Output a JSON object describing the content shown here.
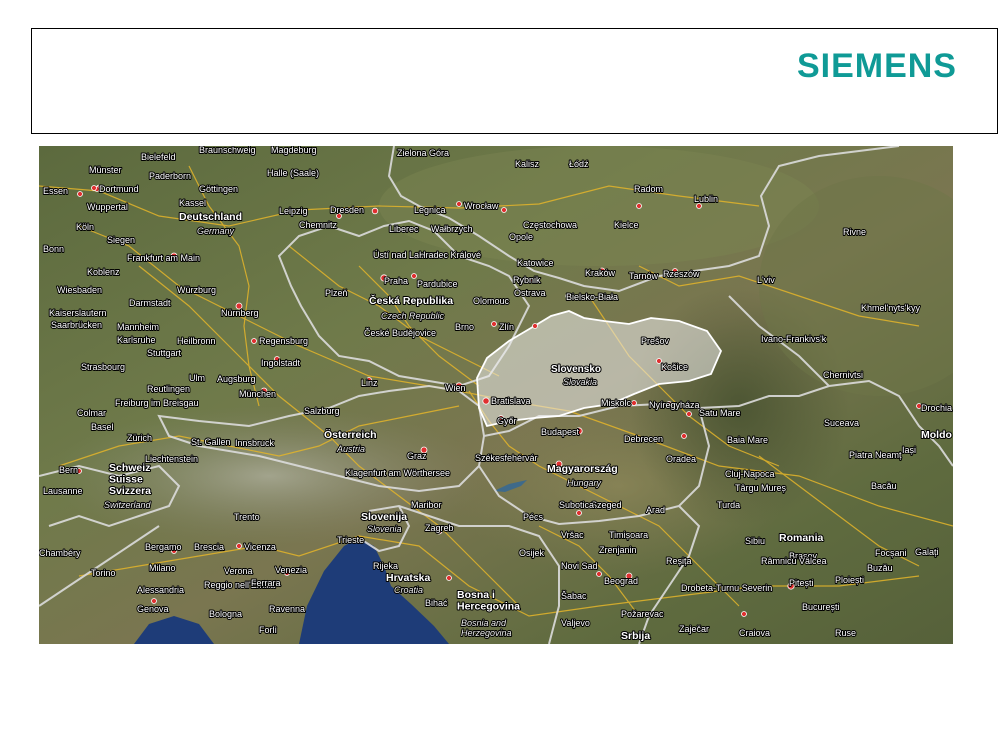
{
  "header": {
    "logo": "SIEMENS"
  },
  "colors": {
    "brand": "#0f9a96",
    "highlight": "#e8e8e8",
    "border": "#d9d9d9",
    "road": "#e4b52a"
  },
  "map": {
    "highlighted_country": {
      "name": "Slovensko",
      "english": "Slovakia"
    },
    "countries": [
      {
        "name": "Deutschland",
        "english": "Germany"
      },
      {
        "name": "Česká Republika",
        "english": "Czech Republic"
      },
      {
        "name": "Österreich",
        "english": "Austria"
      },
      {
        "name": "Magyarország",
        "english": "Hungary"
      },
      {
        "name": "Slovenija",
        "english": "Slovenia"
      },
      {
        "name": "Hrvatska",
        "english": "Croatia"
      },
      {
        "name": "Schweiz\nSuisse\nSvizzera",
        "english": "Switzerland"
      },
      {
        "name": "Bosna i\nHercegovina",
        "english": "Bosnia and\nHerzegovina"
      },
      {
        "name": "Srbija",
        "english": ""
      },
      {
        "name": "Romania",
        "english": ""
      },
      {
        "name": "Moldo",
        "english": ""
      }
    ],
    "cities": [
      "Braunschweig",
      "Magdeburg",
      "Bielefeld",
      "Münster",
      "Paderborn",
      "Halle (Saale)",
      "Zielona Góra",
      "Kalisz",
      "Łódź",
      "Essen",
      "Dortmund",
      "Göttingen",
      "Radom",
      "Lublin",
      "Wuppertal",
      "Kassel",
      "Leipzig",
      "Dresden",
      "Legnica",
      "Wrocław",
      "Częstochowa",
      "Kielce",
      "Köln",
      "Siegen",
      "Chemnitz",
      "Liberec",
      "Wałbrzych",
      "Opole",
      "Rivne",
      "Bonn",
      "Ústí nad Labem",
      "Hradec Králové",
      "Katowice",
      "Frankfurt am Main",
      "Koblenz",
      "Praha",
      "Pardubice",
      "Rybnik",
      "Kraków",
      "Tarnów",
      "Rzeszów",
      "Wiesbaden",
      "Würzburg",
      "Ostrava",
      "L'viv",
      "Darmstadt",
      "Plzeň",
      "Bielsko-Biała",
      "Kaiserslautern",
      "Saarbrücken",
      "Nürnberg",
      "Olomouc",
      "Mannheim",
      "Karlsruhe",
      "Heilbronn",
      "Brno",
      "Zlín",
      "Khmel'nyts'kyy",
      "Regensburg",
      "České Budějovice",
      "Prešov",
      "Ivano-Frankivs'k",
      "Stuttgart",
      "Košice",
      "Strasbourg",
      "Ingolstadt",
      "Ulm",
      "Augsburg",
      "Linz",
      "Wien",
      "Reutlingen",
      "München",
      "Chernivtsi",
      "Bratislava",
      "Miskolc",
      "Nyíregyháza",
      "Freiburg im Breisgau",
      "Colmar",
      "Salzburg",
      "Satu Mare",
      "Győr",
      "Drochia",
      "Basel",
      "Budapest",
      "Zürich",
      "St. Gallen",
      "Innsbruck",
      "Liechtenstein",
      "Debrecen",
      "Baia Mare",
      "Suceava",
      "Iași",
      "Bern",
      "Klagenfurt am Wörthersee",
      "Graz",
      "Székesfehérvár",
      "Oradea",
      "Piatra Neamț",
      "Cluj-Napoca",
      "Târgu Mureș",
      "Lausanne",
      "Bacău",
      "Maribor",
      "Trento",
      "Turda",
      "Pécs",
      "Szeged",
      "Arad",
      "Timișoara",
      "Zagreb",
      "Sibiu",
      "Brașov",
      "Focșani",
      "Galați",
      "Bergamo",
      "Brescia",
      "Vicenza",
      "Trieste",
      "Osijek",
      "Vršac",
      "Zrenjanin",
      "Reșița",
      "Chambéry",
      "Torino",
      "Milano",
      "Verona",
      "Venezia",
      "Rijeka",
      "Novi Sad",
      "Râmnicu Vâlcea",
      "Buzău",
      "Alessandria",
      "Reggio nell'Emilia",
      "Ferrara",
      "Beograd",
      "Drobeta-Turnu Severin",
      "Pitești",
      "Ploiești",
      "Genova",
      "Bologna",
      "Ravenna",
      "Bihać",
      "Šabac",
      "Požarevac",
      "București",
      "Forlì",
      "Valjevo",
      "Zaječar",
      "Craiova",
      "Ruse",
      "Subotica"
    ]
  }
}
